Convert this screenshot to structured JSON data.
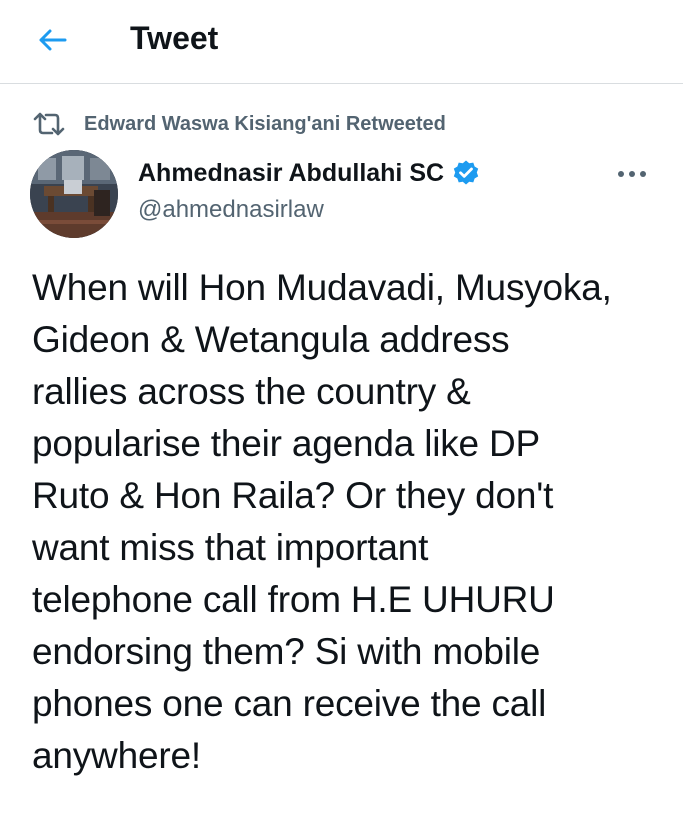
{
  "header": {
    "title": "Tweet",
    "back_icon": "back-arrow-icon"
  },
  "social_context": {
    "icon": "retweet-icon",
    "text": "Edward Waswa Kisiang'ani Retweeted"
  },
  "author": {
    "name": "Ahmednasir Abdullahi SC",
    "handle": "@ahmednasirlaw",
    "verified": true,
    "verified_icon": "verified-badge-icon",
    "avatar_icon": "avatar"
  },
  "more_icon": "more-options-icon",
  "tweet": {
    "text": "When will Hon Mudavadi, Musyoka,\nGideon & Wetangula address\nrallies across the country &\npopularise their agenda like DP\nRuto & Hon Raila? Or they don't\nwant miss that important\ntelephone call from H.E UHURU\nendorsing them? Si with mobile\nphones one can receive the call\nanywhere!"
  },
  "colors": {
    "accent": "#1d9bf0",
    "secondary_text": "#536471",
    "primary_text": "#0f1419",
    "divider": "#d9dde0"
  }
}
